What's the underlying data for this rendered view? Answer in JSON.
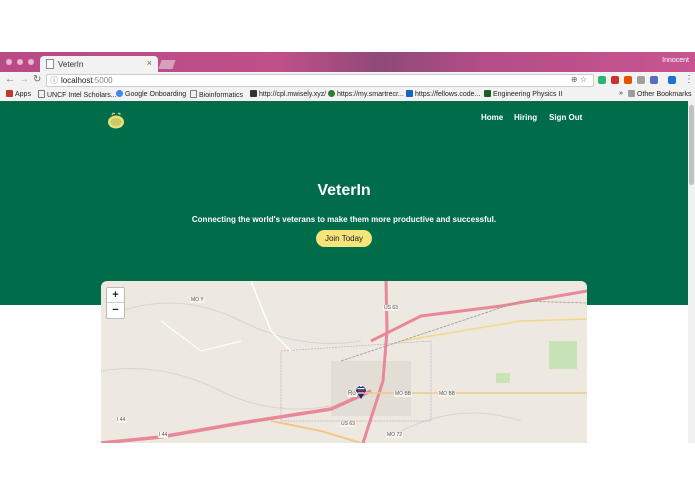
{
  "browser": {
    "tab_title": "VeterIn",
    "tab_close": "×",
    "profile": "Innocent",
    "url_host": "localhost",
    "url_port": ":5000",
    "bookmarks": [
      {
        "label": "Apps",
        "color": "#c0392b"
      },
      {
        "label": "UNCF Intel Scholars...",
        "color": "#7b7b7b"
      },
      {
        "label": "Google Onboarding",
        "color": "#4285f4"
      },
      {
        "label": "Bioinformatics",
        "color": "#9e9e9e"
      },
      {
        "label": "http://cpl.mwisely.xyz/",
        "color": "#333333"
      },
      {
        "label": "https://my.smartrecr...",
        "color": "#2e7d32"
      },
      {
        "label": "https://fellows.code...",
        "color": "#1565c0"
      },
      {
        "label": "Engineering Physics II",
        "color": "#1b5e20"
      }
    ],
    "other_bookmarks": "Other Bookmarks"
  },
  "site": {
    "nav": [
      "Home",
      "Hiring",
      "Sign Out"
    ],
    "title": "VeterIn",
    "tagline": "Connecting the world's veterans to make them more productive and successful.",
    "join_label": "Join Today"
  },
  "map": {
    "zoom_in": "+",
    "zoom_out": "−",
    "labels": [
      "MO Y",
      "US 63",
      "MO BB",
      "MO BB",
      "US 63",
      "MO 72",
      "I 44",
      "I 44",
      "Ro"
    ]
  },
  "colors": {
    "hero": "#006c4a",
    "join_button": "#f5e47a",
    "highway": "#e8889a"
  }
}
